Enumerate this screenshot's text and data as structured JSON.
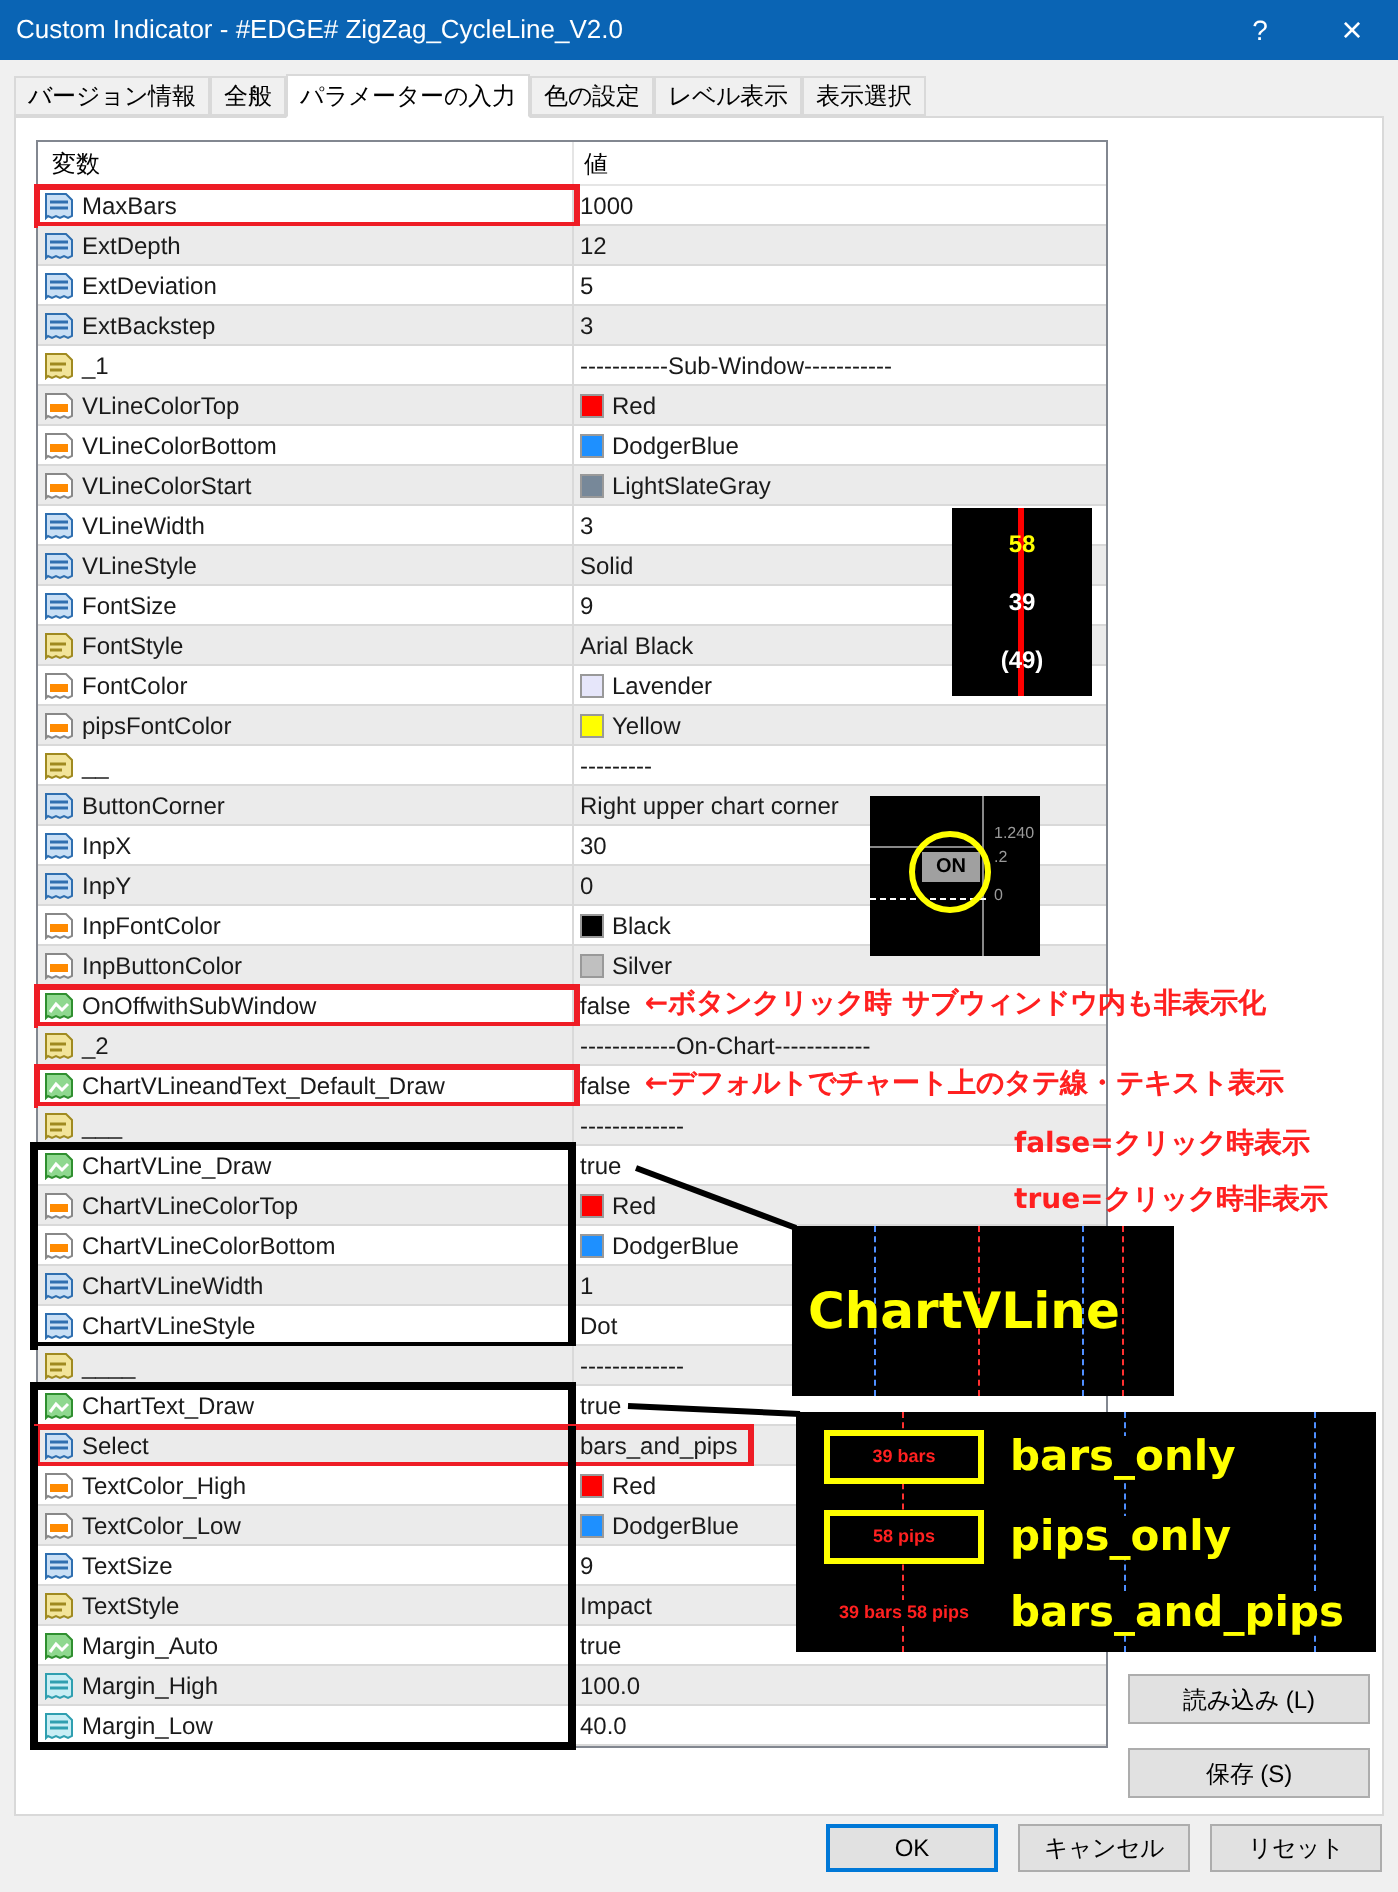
{
  "window": {
    "title": "Custom Indicator - #EDGE# ZigZag_CycleLine_V2.0",
    "help": "?",
    "close": "×"
  },
  "tabs": [
    {
      "label": "バージョン情報",
      "selected": false
    },
    {
      "label": "全般",
      "selected": false
    },
    {
      "label": "パラメーターの入力",
      "selected": true
    },
    {
      "label": "色の設定",
      "selected": false
    },
    {
      "label": "レベル表示",
      "selected": false
    },
    {
      "label": "表示選択",
      "selected": false
    }
  ],
  "table": {
    "columns": [
      "変数",
      "値"
    ],
    "rows": [
      {
        "kind": "int",
        "name": "MaxBars",
        "value": "1000",
        "highlighted": true,
        "value_highlighted": false,
        "framed": false
      },
      {
        "kind": "int",
        "name": "ExtDepth",
        "value": "12",
        "highlighted": false,
        "value_highlighted": false,
        "framed": false
      },
      {
        "kind": "int",
        "name": "ExtDeviation",
        "value": "5",
        "highlighted": false,
        "value_highlighted": false,
        "framed": false
      },
      {
        "kind": "int",
        "name": "ExtBackstep",
        "value": "3",
        "highlighted": false,
        "value_highlighted": false,
        "framed": false
      },
      {
        "kind": "string",
        "name": "_1",
        "value": "-----------Sub-Window-----------",
        "highlighted": false,
        "value_highlighted": false,
        "framed": false
      },
      {
        "kind": "color",
        "name": "VLineColorTop",
        "value": "Red",
        "color": "#ff0000",
        "highlighted": false,
        "value_highlighted": false,
        "framed": false
      },
      {
        "kind": "color",
        "name": "VLineColorBottom",
        "value": "DodgerBlue",
        "color": "#1e90ff",
        "highlighted": false,
        "value_highlighted": false,
        "framed": false
      },
      {
        "kind": "color",
        "name": "VLineColorStart",
        "value": "LightSlateGray",
        "color": "#778899",
        "highlighted": false,
        "value_highlighted": false,
        "framed": false
      },
      {
        "kind": "int",
        "name": "VLineWidth",
        "value": "3",
        "highlighted": false,
        "value_highlighted": false,
        "framed": false
      },
      {
        "kind": "int",
        "name": "VLineStyle",
        "value": "Solid",
        "highlighted": false,
        "value_highlighted": false,
        "framed": false
      },
      {
        "kind": "int",
        "name": "FontSize",
        "value": "9",
        "highlighted": false,
        "value_highlighted": false,
        "framed": false
      },
      {
        "kind": "string",
        "name": "FontStyle",
        "value": "Arial Black",
        "highlighted": false,
        "value_highlighted": false,
        "framed": false
      },
      {
        "kind": "color",
        "name": "FontColor",
        "value": "Lavender",
        "color": "#e6e6fa",
        "highlighted": false,
        "value_highlighted": false,
        "framed": false
      },
      {
        "kind": "color",
        "name": "pipsFontColor",
        "value": "Yellow",
        "color": "#ffff00",
        "highlighted": false,
        "value_highlighted": false,
        "framed": false
      },
      {
        "kind": "string",
        "name": "__",
        "value": "---------",
        "highlighted": false,
        "value_highlighted": false,
        "framed": false
      },
      {
        "kind": "int",
        "name": "ButtonCorner",
        "value": "Right upper chart corner",
        "highlighted": false,
        "value_highlighted": false,
        "framed": false
      },
      {
        "kind": "int",
        "name": "InpX",
        "value": "30",
        "highlighted": false,
        "value_highlighted": false,
        "framed": false
      },
      {
        "kind": "int",
        "name": "InpY",
        "value": "0",
        "highlighted": false,
        "value_highlighted": false,
        "framed": false
      },
      {
        "kind": "color",
        "name": "InpFontColor",
        "value": "Black",
        "color": "#000000",
        "highlighted": false,
        "value_highlighted": false,
        "framed": false
      },
      {
        "kind": "color",
        "name": "InpButtonColor",
        "value": "Silver",
        "color": "#c0c0c0",
        "highlighted": false,
        "value_highlighted": false,
        "framed": false
      },
      {
        "kind": "bool",
        "name": "OnOffwithSubWindow",
        "value": "false",
        "note": "←ボタンクリック時 サブウィンドウ内も非表示化",
        "highlighted": true,
        "value_highlighted": false,
        "framed": false
      },
      {
        "kind": "string",
        "name": "_2",
        "value": "------------On-Chart------------",
        "highlighted": false,
        "value_highlighted": false,
        "framed": false
      },
      {
        "kind": "bool",
        "name": "ChartVLineandText_Default_Draw",
        "value": "false",
        "note": "←デフォルトでチャート上のタテ線・テキスト表示",
        "highlighted": true,
        "value_highlighted": false,
        "framed": false
      },
      {
        "kind": "string",
        "name": "___",
        "value": "-------------",
        "highlighted": false,
        "value_highlighted": false,
        "framed": false
      },
      {
        "kind": "bool",
        "name": "ChartVLine_Draw",
        "value": "true",
        "highlighted": false,
        "value_highlighted": false,
        "framed": true
      },
      {
        "kind": "color",
        "name": "ChartVLineColorTop",
        "value": "Red",
        "color": "#ff0000",
        "highlighted": false,
        "value_highlighted": false,
        "framed": true
      },
      {
        "kind": "color",
        "name": "ChartVLineColorBottom",
        "value": "DodgerBlue",
        "color": "#1e90ff",
        "highlighted": false,
        "value_highlighted": false,
        "framed": true
      },
      {
        "kind": "int",
        "name": "ChartVLineWidth",
        "value": "1",
        "highlighted": false,
        "value_highlighted": false,
        "framed": true
      },
      {
        "kind": "int",
        "name": "ChartVLineStyle",
        "value": "Dot",
        "highlighted": false,
        "value_highlighted": false,
        "framed": true
      },
      {
        "kind": "string",
        "name": "____",
        "value": "-------------",
        "highlighted": false,
        "value_highlighted": false,
        "framed": false
      },
      {
        "kind": "bool",
        "name": "ChartText_Draw",
        "value": "true",
        "highlighted": false,
        "value_highlighted": false,
        "framed": true
      },
      {
        "kind": "int",
        "name": "Select",
        "value": "bars_and_pips",
        "highlighted": true,
        "value_highlighted": true,
        "framed": true
      },
      {
        "kind": "color",
        "name": "TextColor_High",
        "value": "Red",
        "color": "#ff0000",
        "highlighted": false,
        "value_highlighted": false,
        "framed": true
      },
      {
        "kind": "color",
        "name": "TextColor_Low",
        "value": "DodgerBlue",
        "color": "#1e90ff",
        "highlighted": false,
        "value_highlighted": false,
        "framed": true
      },
      {
        "kind": "int",
        "name": "TextSize",
        "value": "9",
        "highlighted": false,
        "value_highlighted": false,
        "framed": true
      },
      {
        "kind": "string",
        "name": "TextStyle",
        "value": "Impact",
        "highlighted": false,
        "value_highlighted": false,
        "framed": true
      },
      {
        "kind": "bool",
        "name": "Margin_Auto",
        "value": "true",
        "highlighted": false,
        "value_highlighted": false,
        "framed": true
      },
      {
        "kind": "double",
        "name": "Margin_High",
        "value": "100.0",
        "highlighted": false,
        "value_highlighted": false,
        "framed": true
      },
      {
        "kind": "double",
        "name": "Margin_Low",
        "value": "40.0",
        "highlighted": false,
        "value_highlighted": false,
        "framed": true
      }
    ]
  },
  "legend": [
    "false=クリック時表示",
    "true=クリック時非表示"
  ],
  "insets": [
    {
      "kind": "subwindow",
      "labels": [
        "58",
        "39",
        "(49)"
      ]
    },
    {
      "kind": "button",
      "label": "ON",
      "axis_labels": [
        "1.240",
        ".2",
        "0"
      ]
    },
    {
      "kind": "vline",
      "title": "ChartVLine"
    },
    {
      "kind": "text_modes",
      "modes": [
        {
          "sample": "39 bars",
          "name": "bars_only",
          "boxed": true
        },
        {
          "sample": "58 pips",
          "name": "pips_only",
          "boxed": true
        },
        {
          "sample": "39 bars 58 pips",
          "name": "bars_and_pips",
          "boxed": false
        }
      ]
    }
  ],
  "side_buttons": [
    "読み込み (L)",
    "保存 (S)"
  ],
  "buttons": [
    {
      "label": "OK",
      "selected": true
    },
    {
      "label": "キャンセル",
      "selected": false
    },
    {
      "label": "リセット",
      "selected": false
    }
  ]
}
